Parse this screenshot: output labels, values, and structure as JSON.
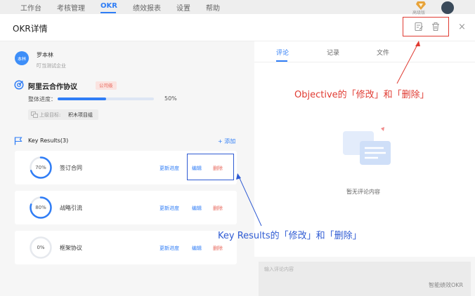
{
  "nav": {
    "items": [
      "工作台",
      "考核管理",
      "OKR",
      "绩效报表",
      "设置",
      "帮助"
    ],
    "active_index": 2,
    "vip_label": "高级版"
  },
  "panel": {
    "title": "OKR详情",
    "close_glyph": "×"
  },
  "owner": {
    "avatar_text": "本林",
    "name": "罗本林",
    "org": "叮当测试企业"
  },
  "objective": {
    "title": "阿里云合作协议",
    "tag": "公司级",
    "progress_label": "整体进度：",
    "progress_value": 50,
    "progress_text": "50%",
    "parent_label": "上级目标:",
    "parent_value": "积木项目组"
  },
  "key_results": {
    "header": "Key Results(3)",
    "add_label": "+ 添加",
    "items": [
      {
        "percent": 70,
        "percent_label": "70%",
        "name": "签订合同",
        "update": "更新进度",
        "edit": "编辑",
        "delete": "删除"
      },
      {
        "percent": 80,
        "percent_label": "80%",
        "name": "战略引流",
        "update": "更新进度",
        "edit": "编辑",
        "delete": "删除"
      },
      {
        "percent": 0,
        "percent_label": "0%",
        "name": "框架协议",
        "update": "更新进度",
        "edit": "编辑",
        "delete": "删除"
      }
    ]
  },
  "tabs": {
    "items": [
      "评论",
      "记录",
      "文件"
    ],
    "active_index": 0
  },
  "comments": {
    "empty_text": "暂无评论内容",
    "input_placeholder": "输入评论内容"
  },
  "watermark": "智能绩效OKR",
  "annotations": {
    "objective_callout": "Objective的「修改」和「删除」",
    "kr_callout": "Key Results的「修改」和「删除」"
  },
  "colors": {
    "accent": "#2f7df6",
    "danger": "#e8685c",
    "annotation_red": "#e03b32",
    "annotation_blue": "#2f5bd3"
  }
}
